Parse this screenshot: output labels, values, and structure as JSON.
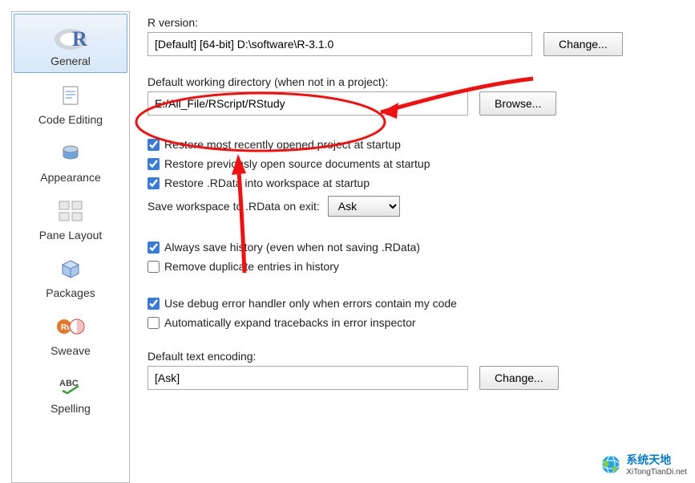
{
  "sidebar": {
    "items": [
      {
        "label": "General"
      },
      {
        "label": "Code Editing"
      },
      {
        "label": "Appearance"
      },
      {
        "label": "Pane Layout"
      },
      {
        "label": "Packages"
      },
      {
        "label": "Sweave"
      },
      {
        "label": "Spelling"
      }
    ]
  },
  "general": {
    "r_version_label": "R version:",
    "r_version_value": "[Default] [64-bit] D:\\software\\R-3.1.0",
    "change_label": "Change...",
    "workdir_label": "Default working directory (when not in a project):",
    "workdir_value": "E:/All_File/RScript/RStudy",
    "browse_label": "Browse...",
    "cb_restore_project": "Restore most recently opened project at startup",
    "cb_restore_docs": "Restore previously open source documents at startup",
    "cb_restore_rdata": "Restore .RData into workspace at startup",
    "save_workspace_label": "Save workspace to .RData on exit:",
    "save_workspace_value": "Ask",
    "cb_save_history": "Always save history (even when not saving .RData)",
    "cb_remove_dup": "Remove duplicate entries in history",
    "cb_debug_handler": "Use debug error handler only when errors contain my code",
    "cb_expand_traceback": "Automatically expand tracebacks in error inspector",
    "encoding_label": "Default text encoding:",
    "encoding_value": "[Ask]",
    "encoding_change_label": "Change..."
  },
  "watermark": {
    "line1": "系统天地",
    "line2": "XiTongTianDi.net"
  }
}
